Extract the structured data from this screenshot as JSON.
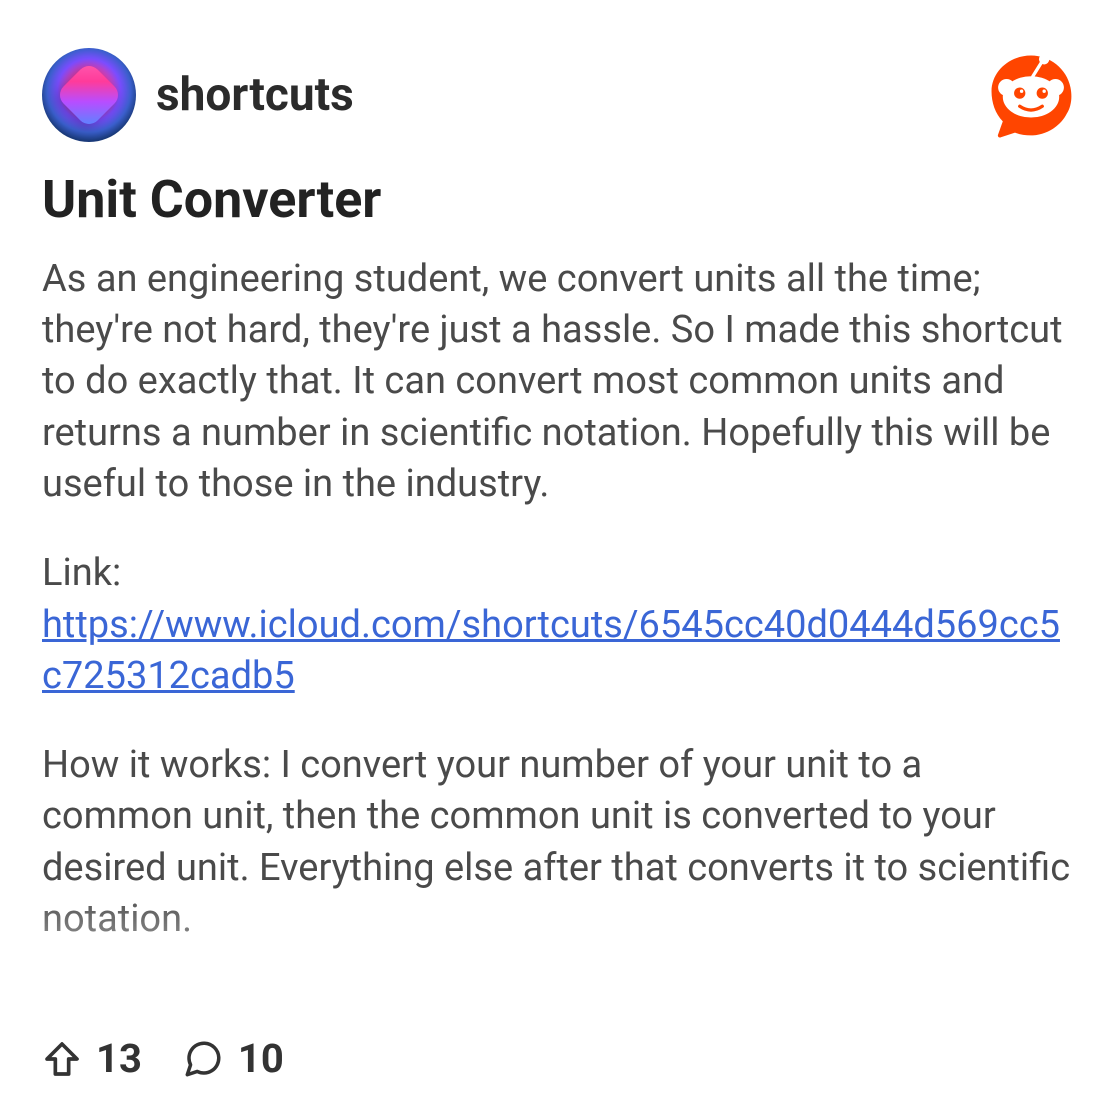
{
  "header": {
    "subreddit_name": "shortcuts"
  },
  "post": {
    "title": "Unit Converter",
    "paragraph1": "As an engineering student, we convert units all the time; they're not hard, they're just a hassle. So I made this shortcut to do exactly that. It can convert most common units and returns a number in scientific notation. Hopefully this will be useful to those in the industry.",
    "link_label": "Link:",
    "link_url": "https://www.icloud.com/shortcuts/6545cc40d0444d569cc5c725312cadb5",
    "paragraph2": "How it works: I convert your number of your unit to a common unit, then the common unit is converted to your desired unit. Everything else after that converts it to scientific notation."
  },
  "footer": {
    "upvotes": "13",
    "comments": "10"
  }
}
